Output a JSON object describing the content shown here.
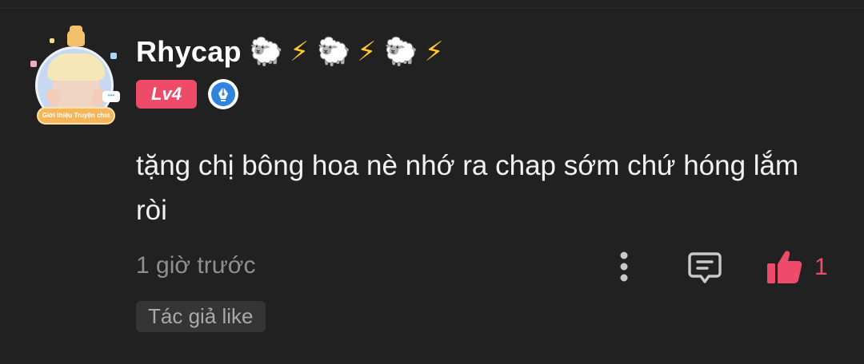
{
  "comment": {
    "user": {
      "name": "Rhycap",
      "name_emojis": [
        "🐑",
        "⚡",
        "🐑",
        "⚡",
        "🐑",
        "⚡"
      ],
      "level": "Lv4",
      "avatar_frame_text": "Giới thiệu Truyện chat",
      "avatar_chat_text": "•••"
    },
    "text": "tặng chị bông hoa nè nhớ ra chap sớm chứ hóng lắm ròi",
    "timestamp": "1 giờ trước",
    "like_count": "1",
    "author_like_label": "Tác giả like"
  },
  "icons": {
    "more": "more-vertical-icon",
    "reply": "comment-reply-icon",
    "like": "thumbs-up-icon",
    "badge": "pen-nib-icon"
  },
  "colors": {
    "background": "#212121",
    "accent": "#ee4b6a",
    "muted_text": "#8f8f8f",
    "tag_background": "#353535",
    "badge_blue": "#2f84e0"
  }
}
